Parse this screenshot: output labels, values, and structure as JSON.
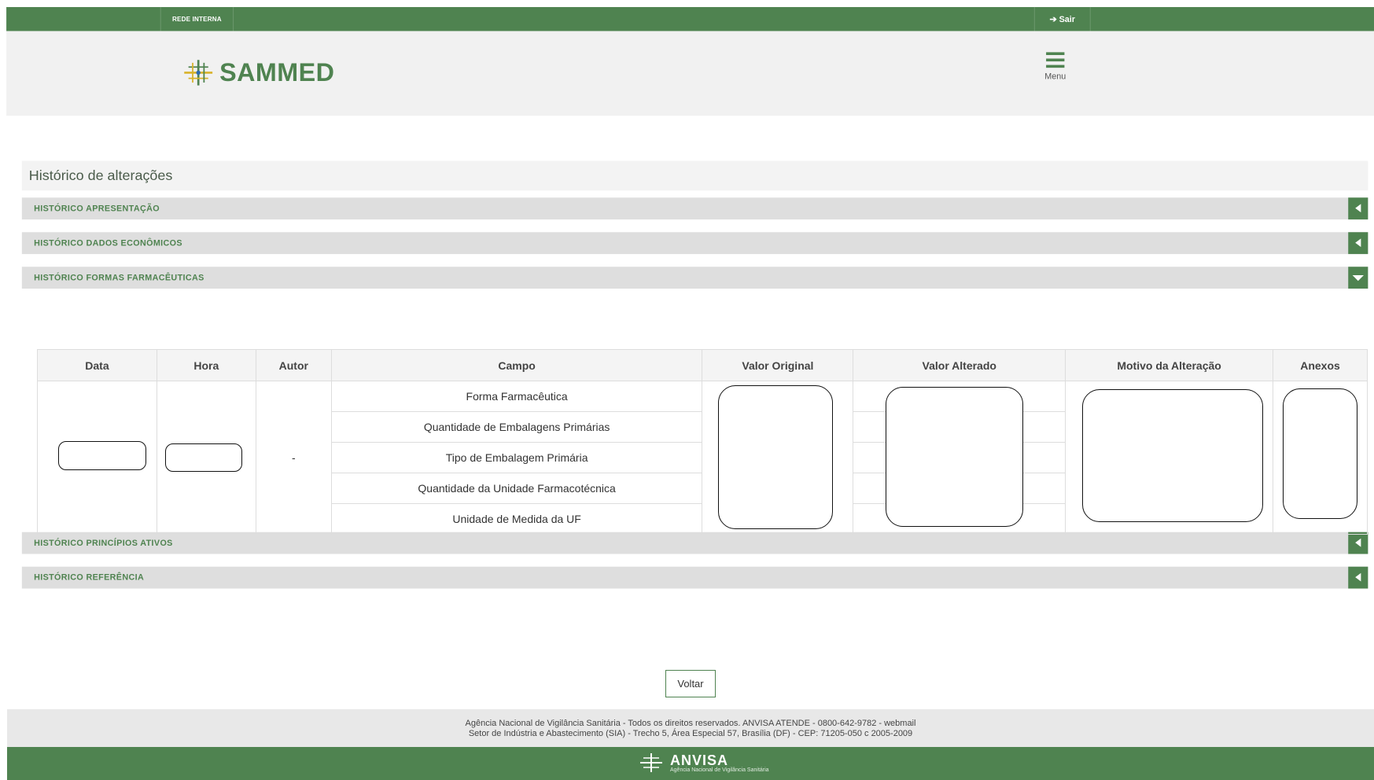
{
  "topbar": {
    "rede_label": "REDE INTERNA",
    "sair_label": "Sair"
  },
  "header": {
    "logo_text": "SAMMED",
    "menu_label": "Menu"
  },
  "page": {
    "title": "Histórico de alterações",
    "sections": [
      {
        "label": "HISTÓRICO APRESENTAÇÃO",
        "expanded": false
      },
      {
        "label": "HISTÓRICO DADOS ECONÔMICOS",
        "expanded": false
      },
      {
        "label": "HISTÓRICO FORMAS FARMACÊUTICAS",
        "expanded": true
      },
      {
        "label": "HISTÓRICO PRINCÍPIOS ATIVOS",
        "expanded": false
      },
      {
        "label": "HISTÓRICO REFERÊNCIA",
        "expanded": false
      }
    ]
  },
  "table": {
    "headers": [
      "Data",
      "Hora",
      "Autor",
      "Campo",
      "Valor Original",
      "Valor Alterado",
      "Motivo da Alteração",
      "Anexos"
    ],
    "autor": "-",
    "campos": [
      "Forma Farmacêutica",
      "Quantidade de Embalagens Primárias",
      "Tipo de Embalagem Primária",
      "Quantidade da Unidade Farmacotécnica",
      "Unidade de Medida da UF"
    ]
  },
  "buttons": {
    "voltar": "Voltar"
  },
  "footer": {
    "line1": "Agência Nacional de Vigilância Sanitária - Todos os direitos reservados. ANVISA ATENDE - 0800-642-9782 - webmail",
    "line2": "Setor de Indústria e Abastecimento (SIA) - Trecho 5, Área Especial 57, Brasília (DF) - CEP: 71205-050 c 2005-2009",
    "brand": "ANVISA",
    "brand_sub": "Agência Nacional de Vigilância Sanitária"
  },
  "colors": {
    "primary": "#4f8350",
    "accordion": "#dedede"
  }
}
